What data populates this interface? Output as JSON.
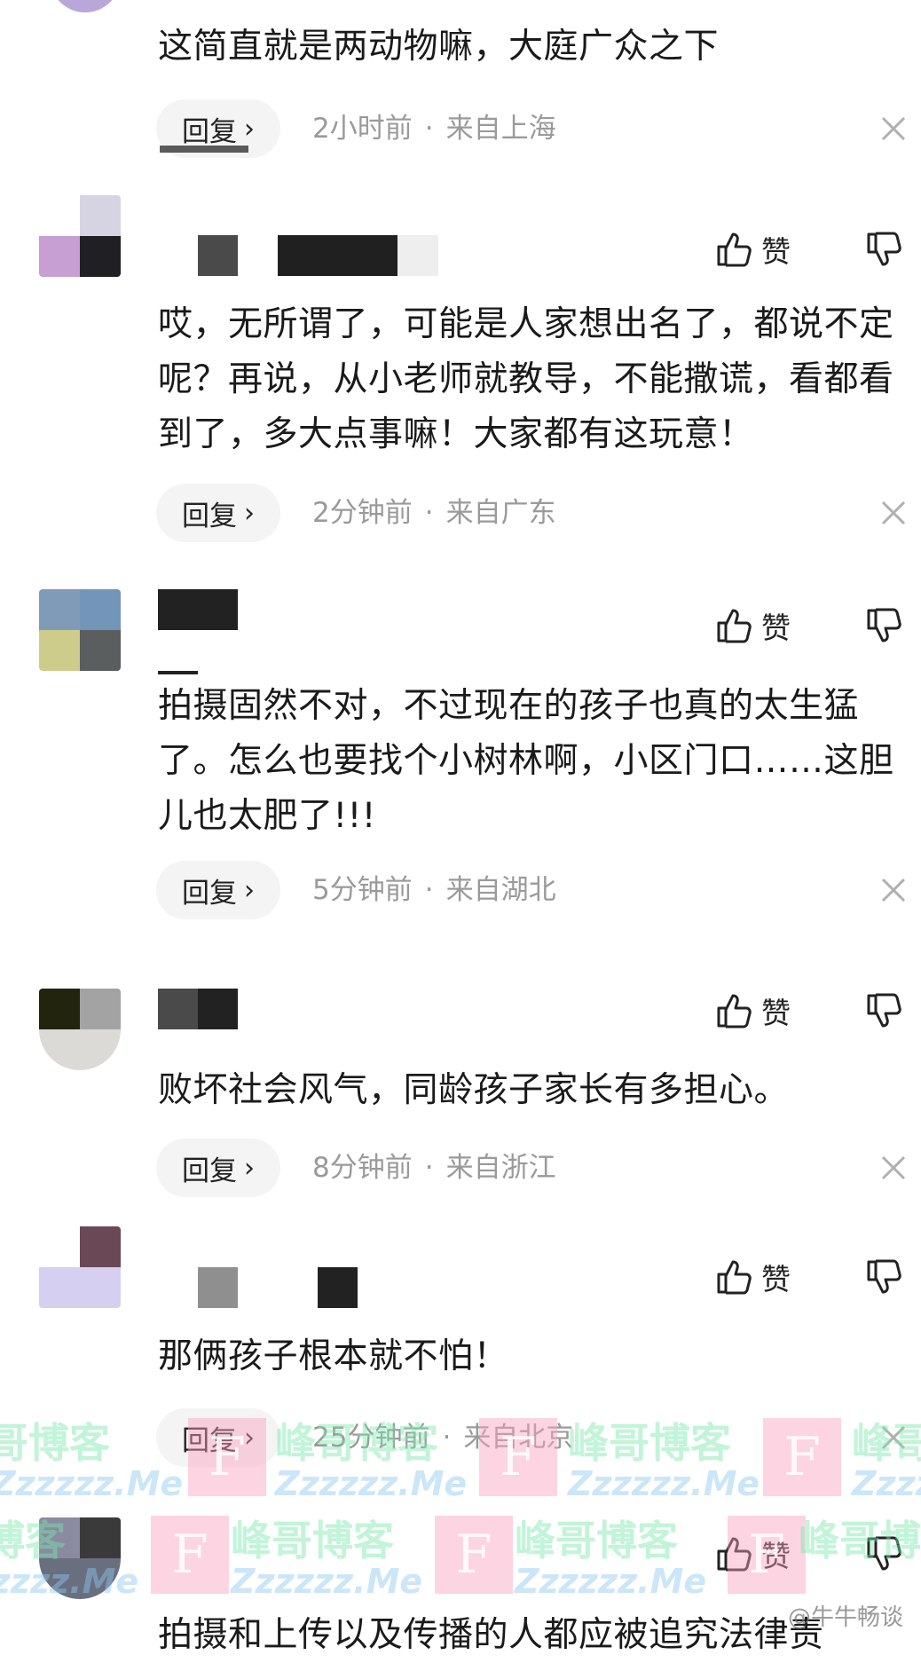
{
  "labels": {
    "like": "赞",
    "reply": "回复"
  },
  "comments": [
    {
      "text": "这简直就是两动物嘛，大庭广众之下",
      "time": "2小时前",
      "location": "来自上海"
    },
    {
      "text": "哎，无所谓了，可能是人家想出名了，都说不定呢？再说，从小老师就教导，不能撒谎，看都看到了，多大点事嘛！大家都有这玩意！",
      "time": "2分钟前",
      "location": "来自广东"
    },
    {
      "text": "拍摄固然不对，不过现在的孩子也真的太生猛了。怎么也要找个小树林啊，小区门口……这胆儿也太肥了!!!",
      "time": "5分钟前",
      "location": "来自湖北"
    },
    {
      "text": "败坏社会风气，同龄孩子家长有多担心。",
      "time": "8分钟前",
      "location": "来自浙江"
    },
    {
      "text": "那俩孩子根本就不怕！",
      "time": "25分钟前",
      "location": "来自北京"
    },
    {
      "text": "拍摄和上传以及传播的人都应被追究法律责",
      "time": "",
      "location": ""
    }
  ],
  "watermark": {
    "cn": "峰哥博客",
    "en": "Zzzzzz.Me",
    "logo": "F"
  },
  "credit": "@牛牛畅谈",
  "colors": {
    "watermark_green": "#78e6aa",
    "watermark_pink": "#faa0be"
  }
}
